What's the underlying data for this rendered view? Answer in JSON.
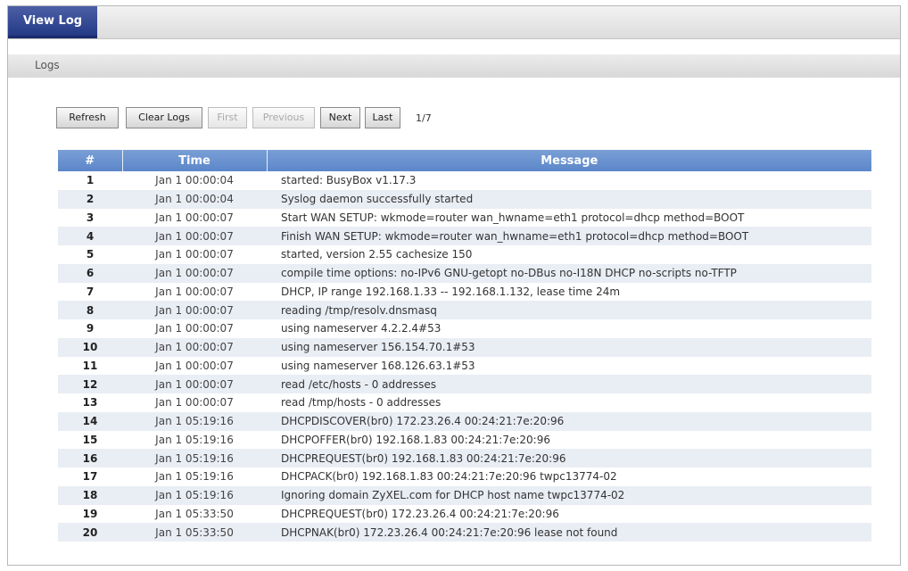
{
  "tab": {
    "label": "View Log"
  },
  "section": {
    "title": "Logs"
  },
  "toolbar": {
    "refresh": "Refresh",
    "clear_logs": "Clear Logs",
    "first": "First",
    "previous": "Previous",
    "next": "Next",
    "last": "Last",
    "page_info": "1/7"
  },
  "table": {
    "headers": {
      "num": "#",
      "time": "Time",
      "message": "Message"
    },
    "rows": [
      {
        "num": "1",
        "time": "Jan 1 00:00:04",
        "message": "started: BusyBox v1.17.3"
      },
      {
        "num": "2",
        "time": "Jan 1 00:00:04",
        "message": "Syslog daemon successfully started"
      },
      {
        "num": "3",
        "time": "Jan 1 00:00:07",
        "message": "Start WAN SETUP: wkmode=router wan_hwname=eth1 protocol=dhcp method=BOOT"
      },
      {
        "num": "4",
        "time": "Jan 1 00:00:07",
        "message": "Finish WAN SETUP: wkmode=router wan_hwname=eth1 protocol=dhcp method=BOOT"
      },
      {
        "num": "5",
        "time": "Jan 1 00:00:07",
        "message": "started, version 2.55 cachesize 150"
      },
      {
        "num": "6",
        "time": "Jan 1 00:00:07",
        "message": "compile time options: no-IPv6 GNU-getopt no-DBus no-I18N DHCP no-scripts no-TFTP"
      },
      {
        "num": "7",
        "time": "Jan 1 00:00:07",
        "message": "DHCP, IP range 192.168.1.33 -- 192.168.1.132, lease time 24m"
      },
      {
        "num": "8",
        "time": "Jan 1 00:00:07",
        "message": "reading /tmp/resolv.dnsmasq"
      },
      {
        "num": "9",
        "time": "Jan 1 00:00:07",
        "message": "using nameserver 4.2.2.4#53"
      },
      {
        "num": "10",
        "time": "Jan 1 00:00:07",
        "message": "using nameserver 156.154.70.1#53"
      },
      {
        "num": "11",
        "time": "Jan 1 00:00:07",
        "message": "using nameserver 168.126.63.1#53"
      },
      {
        "num": "12",
        "time": "Jan 1 00:00:07",
        "message": "read /etc/hosts - 0 addresses"
      },
      {
        "num": "13",
        "time": "Jan 1 00:00:07",
        "message": "read /tmp/hosts - 0 addresses"
      },
      {
        "num": "14",
        "time": "Jan 1 05:19:16",
        "message": "DHCPDISCOVER(br0) 172.23.26.4 00:24:21:7e:20:96"
      },
      {
        "num": "15",
        "time": "Jan 1 05:19:16",
        "message": "DHCPOFFER(br0) 192.168.1.83 00:24:21:7e:20:96"
      },
      {
        "num": "16",
        "time": "Jan 1 05:19:16",
        "message": "DHCPREQUEST(br0) 192.168.1.83 00:24:21:7e:20:96"
      },
      {
        "num": "17",
        "time": "Jan 1 05:19:16",
        "message": "DHCPACK(br0) 192.168.1.83 00:24:21:7e:20:96 twpc13774-02"
      },
      {
        "num": "18",
        "time": "Jan 1 05:19:16",
        "message": "Ignoring domain ZyXEL.com for DHCP host name twpc13774-02"
      },
      {
        "num": "19",
        "time": "Jan 1 05:33:50",
        "message": "DHCPREQUEST(br0) 172.23.26.4 00:24:21:7e:20:96"
      },
      {
        "num": "20",
        "time": "Jan 1 05:33:50",
        "message": "DHCPNAK(br0) 172.23.26.4 00:24:21:7e:20:96 lease not found"
      }
    ]
  }
}
